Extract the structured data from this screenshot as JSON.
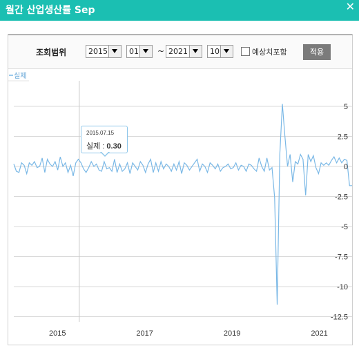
{
  "window": {
    "title": "월간 산업생산률 Sep",
    "close_icon": "close-icon"
  },
  "filter": {
    "range_label": "조회범위",
    "start_year": "2015",
    "start_month": "01",
    "separator": "~",
    "end_year": "2021",
    "end_month": "10",
    "forecast_label": "예상치포함",
    "forecast_checked": false,
    "apply_label": "적용"
  },
  "colors": {
    "accent": "#1bbfb2",
    "series": "#7ab8e6",
    "grid": "#d9d9d9"
  },
  "tooltip": {
    "date": "2015.07.15",
    "label": "실제 : ",
    "value": "0.30"
  },
  "chart_data": {
    "type": "line",
    "legend": "실제",
    "legend_position": "top-left",
    "x_tick_labels": [
      "2015",
      "2017",
      "2019",
      "2021"
    ],
    "y_tick_labels": [
      "5",
      "2.5",
      "0",
      "-2.5",
      "-5",
      "-7.5",
      "-10",
      "-12.5"
    ],
    "y_ticks": [
      5,
      2.5,
      0,
      -2.5,
      -5,
      -7.5,
      -10,
      -12.5
    ],
    "ylim": [
      -12.5,
      5
    ],
    "x_start": "2014-01",
    "x_end": "2021-10",
    "grid": true,
    "series": [
      {
        "name": "실제",
        "values": [
          0.2,
          -0.4,
          -0.5,
          0.3,
          0.1,
          -0.6,
          0.3,
          0.1,
          0.4,
          -0.1,
          0.0,
          0.7,
          -0.5,
          0.6,
          0.2,
          0.0,
          0.4,
          -0.3,
          0.8,
          0.0,
          0.3,
          -0.5,
          0.1,
          -0.8,
          0.3,
          0.6,
          0.3,
          -0.2,
          -0.5,
          -0.1,
          0.4,
          0.0,
          0.2,
          -0.3,
          -0.4,
          0.4,
          -0.2,
          -0.1,
          -0.4,
          0.6,
          -0.5,
          0.2,
          -0.4,
          -0.2,
          0.3,
          -0.6,
          0.3,
          0.0,
          -0.3,
          0.4,
          0.1,
          -0.5,
          0.2,
          0.6,
          -0.5,
          0.3,
          -0.4,
          0.4,
          -0.2,
          0.2,
          0.0,
          -0.4,
          0.2,
          -0.3,
          0.4,
          -0.6,
          0.3,
          0.1,
          -0.3,
          0.0,
          0.3,
          0.6,
          -0.4,
          0.2,
          0.0,
          -0.5,
          0.3,
          0.1,
          -0.2,
          0.2,
          -0.4,
          -0.1,
          0.0,
          0.2,
          -0.2,
          -0.1,
          0.3,
          -0.3,
          0.1,
          0.0,
          -0.4,
          0.2,
          0.1,
          -0.2,
          -0.4,
          0.7,
          0.0,
          -0.4,
          0.7,
          -0.3,
          -0.1,
          -2.6,
          -11.5,
          1.0,
          5.2,
          2.5,
          0.0,
          1.0,
          -1.3,
          0.4,
          0.2,
          1.0,
          0.6,
          -2.4,
          1.0,
          0.4,
          0.9,
          -0.1,
          -0.6,
          0.3,
          0.1,
          0.3,
          0.1,
          0.5,
          0.8,
          0.3,
          0.7,
          0.3,
          0.6,
          0.5,
          -1.6,
          -1.6
        ]
      }
    ]
  }
}
